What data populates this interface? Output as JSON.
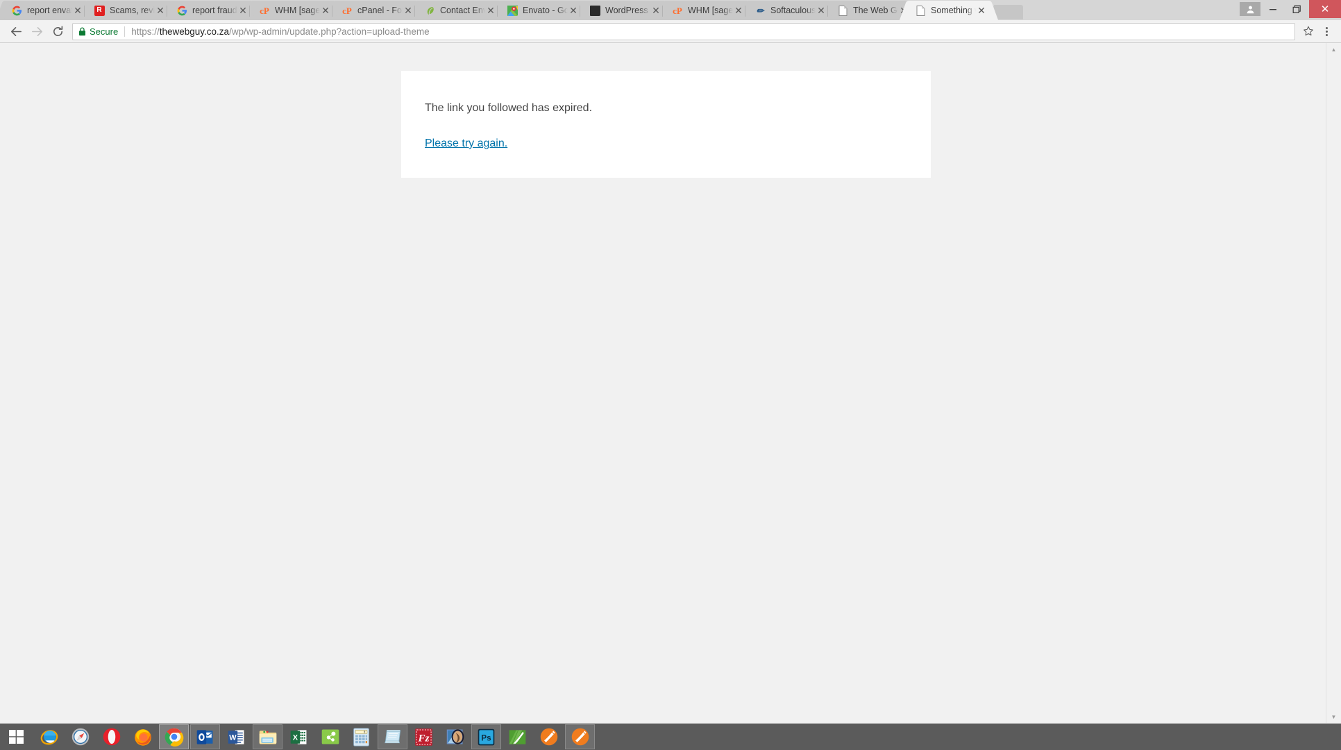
{
  "browser": {
    "tabs": [
      {
        "title": "report envato m",
        "favicon": "google-g-icon",
        "active": false
      },
      {
        "title": "Scams, reviews",
        "favicon": "scamadviser-icon",
        "active": false
      },
      {
        "title": "report fraudulan",
        "favicon": "google-g-icon",
        "active": false
      },
      {
        "title": "WHM [sage] List",
        "favicon": "cpanel-icon",
        "active": false
      },
      {
        "title": "cPanel - Forward",
        "favicon": "cpanel-icon",
        "active": false
      },
      {
        "title": "Contact Envato",
        "favicon": "envato-leaf-icon",
        "active": false
      },
      {
        "title": "Envato - Google",
        "favicon": "google-maps-icon",
        "active": false
      },
      {
        "title": "WordPress Them",
        "favicon": "wordpress-theme-icon",
        "active": false
      },
      {
        "title": "WHM [sage] List",
        "favicon": "cpanel-icon",
        "active": false
      },
      {
        "title": "Softaculous - So",
        "favicon": "softaculous-icon",
        "active": false
      },
      {
        "title": "The Web Guy –",
        "favicon": "generic-page-icon",
        "active": false
      },
      {
        "title": "Something wen",
        "favicon": "generic-page-icon",
        "active": true
      }
    ],
    "new_tab_label": "New Tab",
    "window_controls": {
      "profile": "profile-icon",
      "minimize": "–",
      "maximize": "❐",
      "close": "✕"
    },
    "toolbar": {
      "back_label": "Back",
      "forward_label": "Forward",
      "reload_label": "Reload",
      "secure_label": "Secure",
      "url_full": "https://thewebguy.co.za/wp/wp-admin/update.php?action=upload-theme",
      "url_scheme": "https://",
      "url_host": "thewebguy.co.za",
      "url_path": "/wp/wp-admin/update.php?action=upload-theme",
      "bookmark_label": "Bookmark this page",
      "menu_label": "Customize and control Google Chrome",
      "secure_color": "#0b7a33"
    }
  },
  "page": {
    "error_message": "The link you followed has expired.",
    "retry_link": "Please try again.",
    "link_color": "#0073aa",
    "background_color": "#f1f1f1",
    "card_background": "#ffffff"
  },
  "taskbar": {
    "background_color": "#5b5b5b",
    "start_label": "Start",
    "items": [
      {
        "name": "internet-explorer-icon",
        "label": "Internet Explorer",
        "state": "pinned"
      },
      {
        "name": "safari-icon",
        "label": "Safari",
        "state": "pinned"
      },
      {
        "name": "opera-icon",
        "label": "Opera",
        "state": "pinned"
      },
      {
        "name": "firefox-icon",
        "label": "Mozilla Firefox",
        "state": "pinned"
      },
      {
        "name": "google-chrome-icon",
        "label": "Google Chrome",
        "state": "active"
      },
      {
        "name": "outlook-icon",
        "label": "Microsoft Outlook",
        "state": "running"
      },
      {
        "name": "word-icon",
        "label": "Microsoft Word",
        "state": "pinned"
      },
      {
        "name": "file-explorer-icon",
        "label": "File Explorer",
        "state": "running"
      },
      {
        "name": "excel-icon",
        "label": "Microsoft Excel",
        "state": "pinned"
      },
      {
        "name": "publisher-icon",
        "label": "Microsoft Publisher",
        "state": "pinned"
      },
      {
        "name": "calculator-icon",
        "label": "Calculator",
        "state": "pinned"
      },
      {
        "name": "notepad-icon",
        "label": "Notepad",
        "state": "running"
      },
      {
        "name": "filezilla-icon",
        "label": "FileZilla",
        "state": "pinned"
      },
      {
        "name": "photo-viewer-icon",
        "label": "Photo Viewer",
        "state": "pinned"
      },
      {
        "name": "photoshop-icon",
        "label": "Adobe Photoshop",
        "state": "running"
      },
      {
        "name": "coreldraw-icon",
        "label": "CorelDRAW",
        "state": "pinned"
      },
      {
        "name": "sublime-text-icon",
        "label": "Sublime Text",
        "state": "pinned"
      },
      {
        "name": "sublime-text-icon-2",
        "label": "Sublime Text",
        "state": "running"
      }
    ]
  }
}
